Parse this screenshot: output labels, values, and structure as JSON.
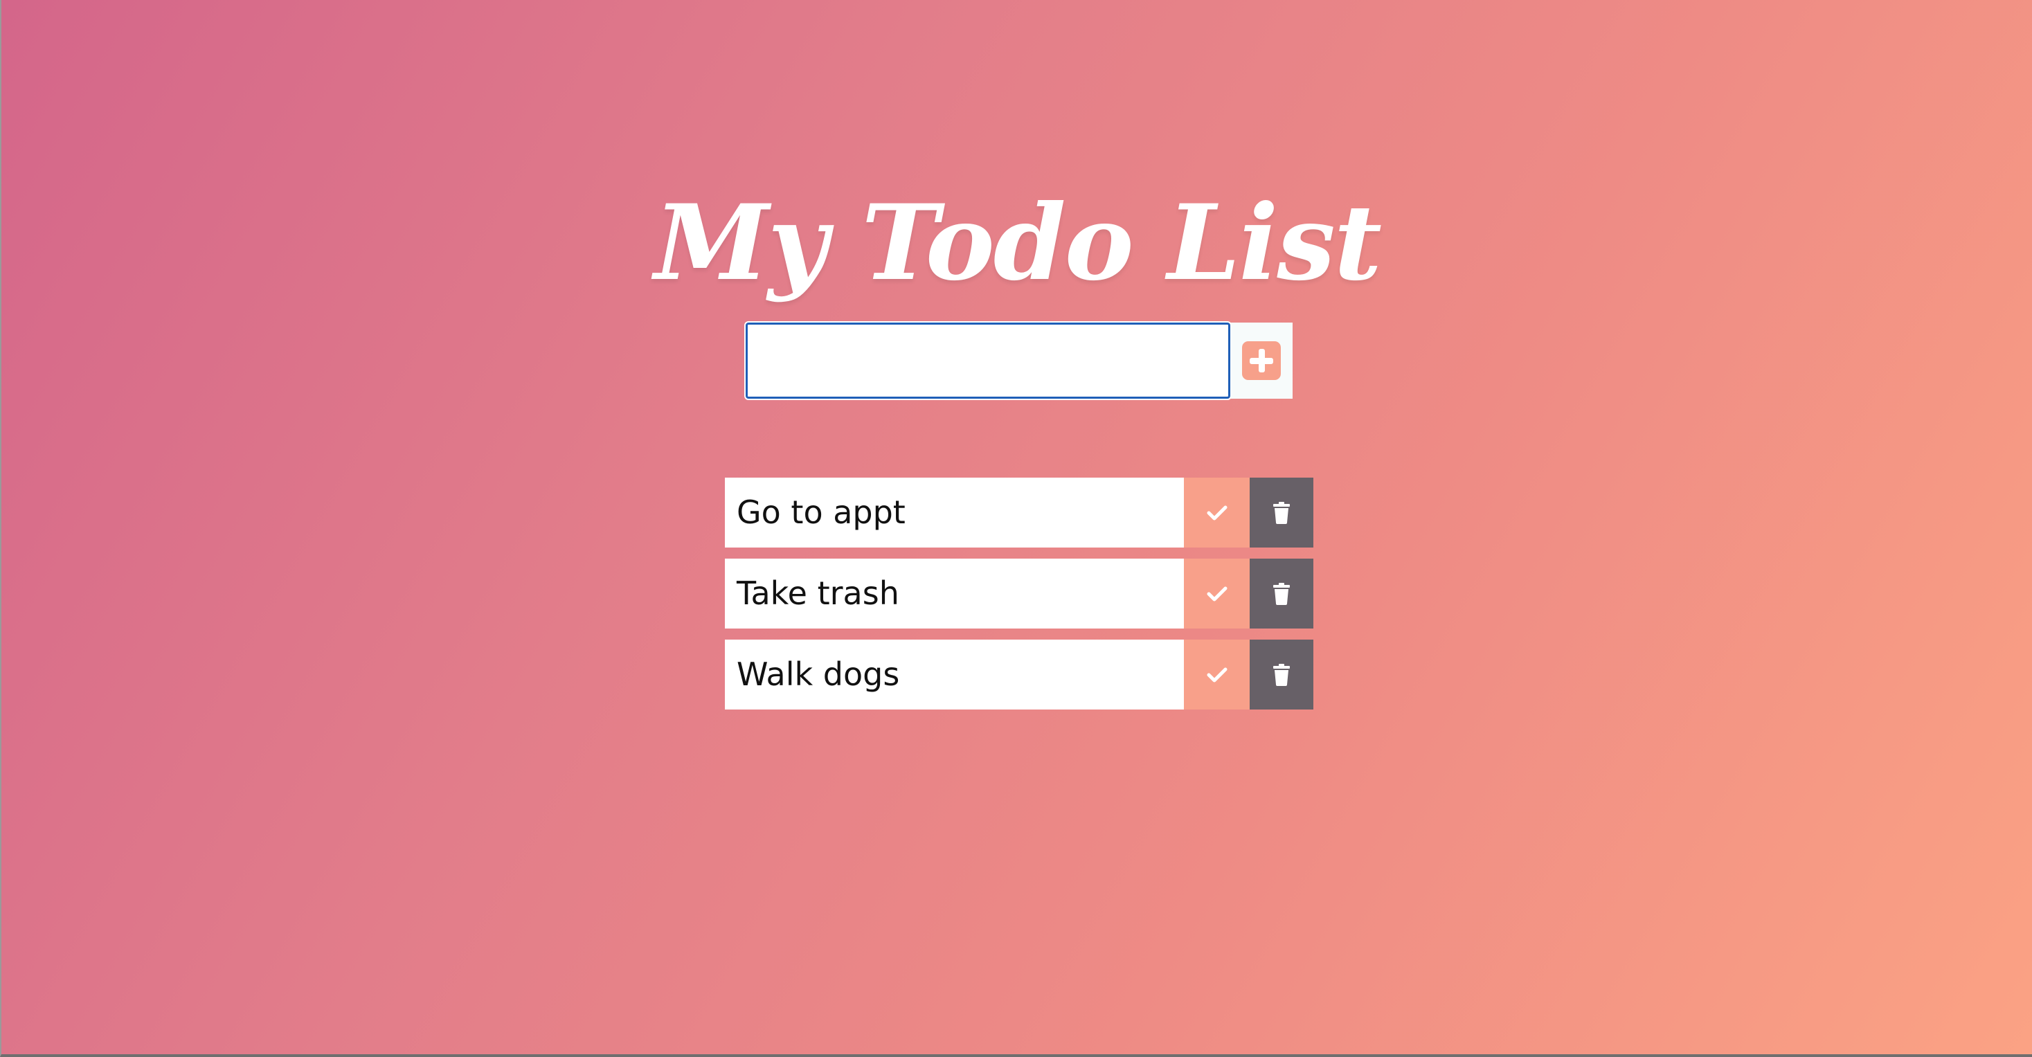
{
  "app": {
    "title": "My Todo List",
    "background_gradient": [
      "#d4668a",
      "#fba284"
    ]
  },
  "new_todo": {
    "value": "",
    "placeholder": "",
    "add_icon": "plus-square-icon",
    "accent_color": "#f7a08a"
  },
  "todos": [
    {
      "text": "Go to appt",
      "complete_icon": "check-icon",
      "delete_icon": "trash-icon"
    },
    {
      "text": "Take trash",
      "complete_icon": "check-icon",
      "delete_icon": "trash-icon"
    },
    {
      "text": "Walk dogs",
      "complete_icon": "check-icon",
      "delete_icon": "trash-icon"
    }
  ],
  "colors": {
    "complete_button": "#f8a08a",
    "delete_button": "#676067",
    "item_background": "#ffffff"
  }
}
